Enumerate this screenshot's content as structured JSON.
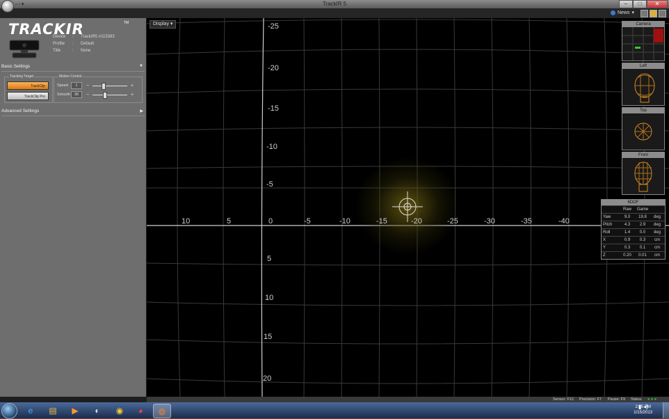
{
  "window": {
    "title": "TrackIR 5"
  },
  "menubar": {
    "news_label": "News"
  },
  "sidebar": {
    "logo": "TRACKIR",
    "trademark": "TM",
    "device": {
      "device_label": "Device",
      "device_value": "TrackIR5 #115383",
      "profile_label": "Profile",
      "profile_value": "Default",
      "title_label": "Title",
      "title_value": "None"
    },
    "basic_settings": "Basic Settings",
    "tracking_target_label": "Tracking Target",
    "target_buttons": [
      "TrackClip",
      "TrackClip Pro"
    ],
    "motion_control_label": "Motion Control",
    "speed": {
      "label": "Speed",
      "value": "1",
      "fraction": 0.25
    },
    "smooth": {
      "label": "Smooth",
      "value": "30",
      "fraction": 0.3
    },
    "advanced_settings": "Advanced Settings"
  },
  "viewport": {
    "display_dropdown": "Display",
    "y_ticks_top": [
      "-25",
      "-20",
      "-15",
      "-10",
      "-5"
    ],
    "x_ticks_left": [
      "10",
      "5",
      "0"
    ],
    "x_ticks_right": [
      "-5",
      "-10",
      "-15",
      "-20",
      "-25",
      "-30",
      "-35",
      "-40"
    ],
    "y_ticks_bottom": [
      "5",
      "10",
      "15",
      "20"
    ]
  },
  "panels": {
    "camera": "Camera",
    "left": "Left",
    "top": "Top",
    "front": "Front"
  },
  "six_dof": {
    "title": "6DOF",
    "headers": [
      "",
      "Raw",
      "Game",
      ""
    ],
    "rows": [
      {
        "name": "Yaw",
        "raw": "9.0",
        "game": "19.8",
        "unit": "deg"
      },
      {
        "name": "Pitch",
        "raw": "4.3",
        "game": "2.9",
        "unit": "deg"
      },
      {
        "name": "Roll",
        "raw": "1.4",
        "game": "0.0",
        "unit": "deg"
      },
      {
        "name": "X",
        "raw": "0.9",
        "game": "0.3",
        "unit": "cm"
      },
      {
        "name": "Y",
        "raw": "0.3",
        "game": "0.1",
        "unit": "cm"
      },
      {
        "name": "Z",
        "raw": "0.20",
        "game": "0.01",
        "unit": "cm"
      }
    ]
  },
  "statusbar": {
    "sensor": "Sensor: F12",
    "precision": "Precision: F7",
    "paused": "Pause: F9",
    "status": "Status"
  },
  "taskbar": {
    "time": "2:35 PM",
    "date": "1/15/2013"
  },
  "colors": {
    "accent": "#e07a10",
    "viewport_bg": "#000000",
    "sidebar_bg": "#6e6e6e"
  },
  "icons": [
    "app-orb-icon",
    "minimize-icon",
    "maximize-icon",
    "close-icon",
    "news-icon",
    "start-orb-icon",
    "ie-icon",
    "explorer-icon",
    "media-icon",
    "steam-icon",
    "chrome-icon",
    "trackir-icon",
    "volume-icon",
    "network-icon"
  ]
}
